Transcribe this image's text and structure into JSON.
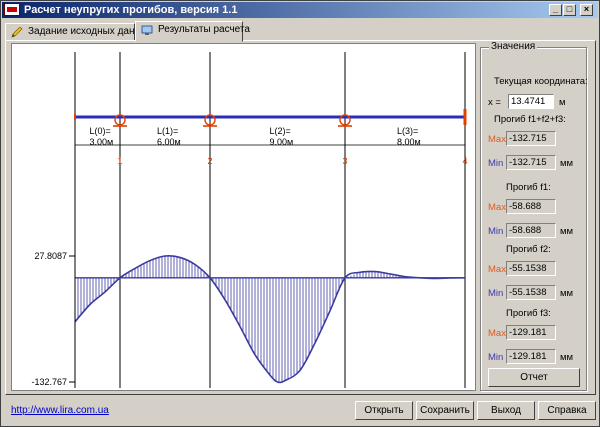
{
  "window": {
    "title": "Расчет неупругих прогибов, версия 1.1"
  },
  "tabs": [
    {
      "label": "Задание исходных данных",
      "icon": "pencil-icon"
    },
    {
      "label": "Результаты расчета",
      "icon": "monitor-icon"
    }
  ],
  "beam": {
    "spans": [
      {
        "label": "L(0)=",
        "value": "3.00м"
      },
      {
        "label": "L(1)=",
        "value": "6.00м"
      },
      {
        "label": "L(2)=",
        "value": "9.00м"
      },
      {
        "label": "L(3)=",
        "value": "8.00м"
      }
    ],
    "supports": [
      "1",
      "2",
      "3",
      "4"
    ],
    "colors": {
      "beam": "#2c2cb8",
      "support": "#e04000",
      "curve": "#3a3aa0"
    }
  },
  "chart_data": {
    "type": "line",
    "y_tick_labels": [
      "27.8087",
      "-132.767"
    ],
    "ylim": [
      -132.767,
      27.8087
    ],
    "x_range": [
      0,
      26
    ],
    "support_x": [
      3,
      9,
      18,
      26
    ],
    "curve": [
      [
        0,
        -56
      ],
      [
        1,
        -34
      ],
      [
        2,
        -18
      ],
      [
        3,
        0
      ],
      [
        4,
        12
      ],
      [
        5,
        22
      ],
      [
        6,
        27.8
      ],
      [
        7,
        26
      ],
      [
        8,
        17
      ],
      [
        9,
        0
      ],
      [
        10,
        -28
      ],
      [
        11,
        -62
      ],
      [
        12,
        -98
      ],
      [
        13,
        -124
      ],
      [
        13.5,
        -132.7
      ],
      [
        14,
        -131
      ],
      [
        15,
        -118
      ],
      [
        16,
        -83
      ],
      [
        17,
        -42
      ],
      [
        18,
        0
      ],
      [
        19,
        7
      ],
      [
        20,
        8
      ],
      [
        21,
        5
      ],
      [
        22,
        1.5
      ],
      [
        23,
        0
      ],
      [
        24,
        -0.8
      ],
      [
        25,
        -0.2
      ],
      [
        26,
        0
      ]
    ]
  },
  "panel": {
    "title": "Значения",
    "coord_label": "Текущая координата:",
    "x_label": "x =",
    "x_value": "13.4741",
    "x_unit": "м",
    "sections": [
      {
        "title": "Прогиб f1+f2+f3:",
        "max": "-132.715",
        "min": "-132.715"
      },
      {
        "title": "Прогиб f1:",
        "max": "-58.688",
        "min": "-58.688"
      },
      {
        "title": "Прогиб f2:",
        "max": "-55.1538",
        "min": "-55.1538"
      },
      {
        "title": "Прогиб f3:",
        "max": "-129.181",
        "min": "-129.181"
      }
    ],
    "max_label": "Max",
    "min_label": "Min",
    "unit": "мм",
    "report_button": "Отчет"
  },
  "footer": {
    "link": "http://www.lira.com.ua",
    "buttons": [
      "Открыть",
      "Сохранить",
      "Выход",
      "Справка"
    ]
  }
}
